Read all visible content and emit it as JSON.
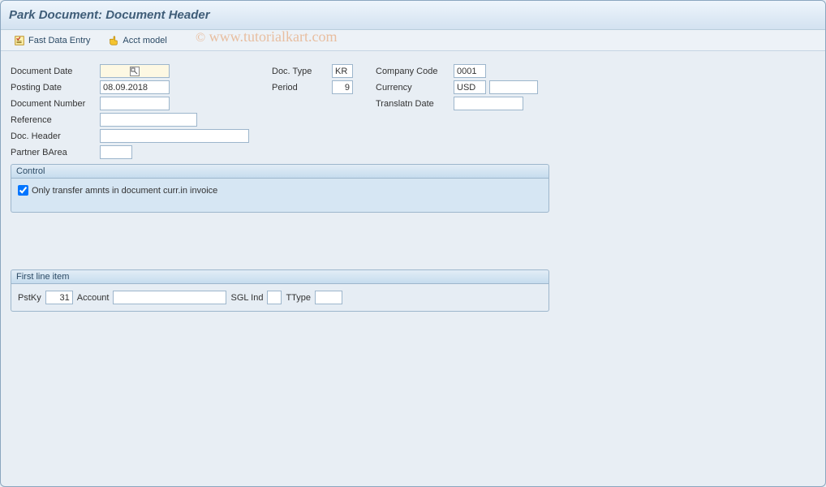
{
  "title": "Park Document: Document Header",
  "toolbar": {
    "fast_data_entry": "Fast Data Entry",
    "acct_model": "Acct model"
  },
  "fields": {
    "document_date": {
      "label": "Document Date",
      "value": ""
    },
    "posting_date": {
      "label": "Posting Date",
      "value": "08.09.2018"
    },
    "document_number": {
      "label": "Document Number",
      "value": ""
    },
    "reference": {
      "label": "Reference",
      "value": ""
    },
    "doc_header": {
      "label": "Doc. Header",
      "value": ""
    },
    "partner_barea": {
      "label": "Partner BArea",
      "value": ""
    },
    "doc_type": {
      "label": "Doc. Type",
      "value": "KR"
    },
    "period": {
      "label": "Period",
      "value": "9"
    },
    "company_code": {
      "label": "Company Code",
      "value": "0001"
    },
    "currency": {
      "label": "Currency",
      "value": "USD",
      "value2": ""
    },
    "translatn_date": {
      "label": "Translatn Date",
      "value": ""
    }
  },
  "control": {
    "title": "Control",
    "checkbox_label": "Only transfer amnts in document curr.in invoice",
    "checkbox_checked": true
  },
  "line_item": {
    "title": "First line item",
    "pstky_label": "PstKy",
    "pstky_value": "31",
    "account_label": "Account",
    "account_value": "",
    "sgl_ind_label": "SGL Ind",
    "sgl_ind_value": "",
    "ttype_label": "TType",
    "ttype_value": ""
  },
  "watermark": "www.tutorialkart.com"
}
